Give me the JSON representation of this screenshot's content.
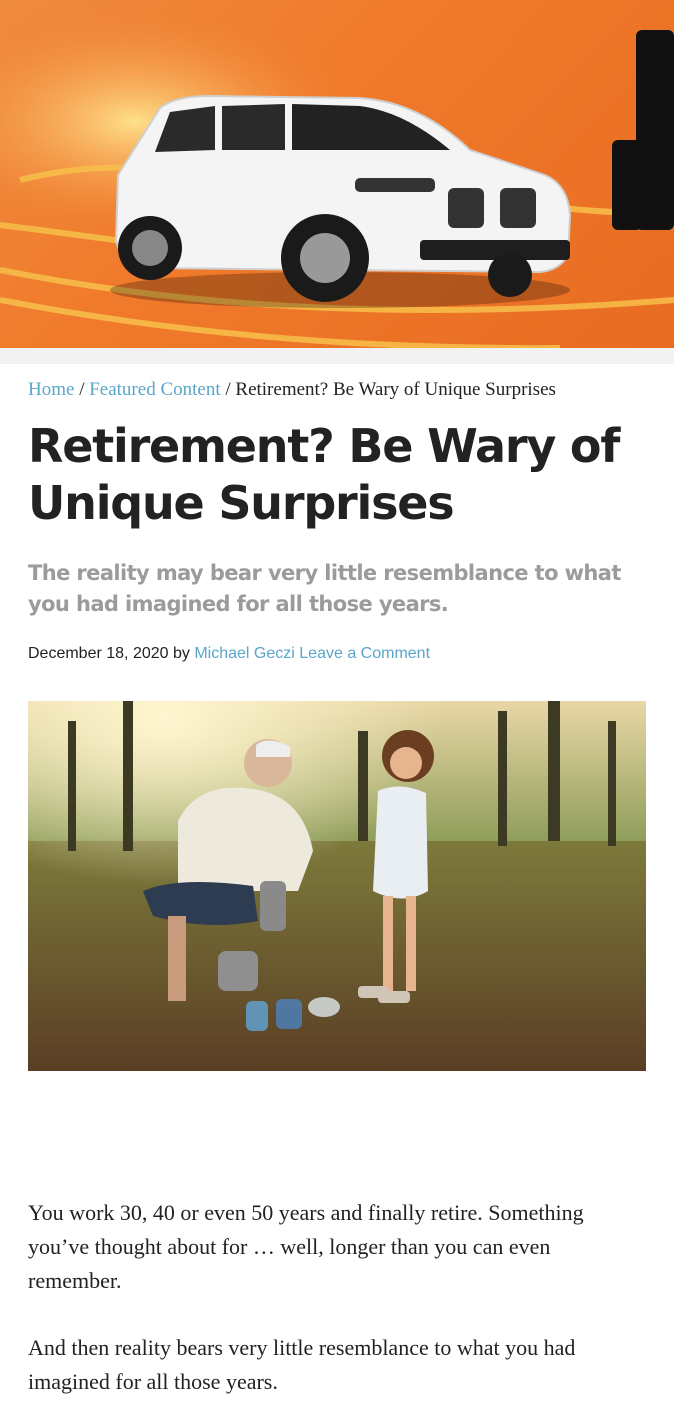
{
  "breadcrumb": {
    "home": "Home",
    "separator": "/",
    "category": "Featured Content",
    "current": "Retirement? Be Wary of Unique Surprises"
  },
  "article": {
    "title": "Retirement? Be Wary of Unique Surprises",
    "subtitle": "The reality may bear very little resemblance to what you had imagined for all those years.",
    "date": "December 18, 2020",
    "by": "by",
    "author": "Michael Geczi",
    "comment_link": "Leave a Comment",
    "paragraphs": [
      "You work 30, 40 or even 50 years and finally retire. Something you’ve thought about for … well, longer than you can even remember.",
      "And then reality bears very little resemblance to what you had imagined for all those years."
    ]
  },
  "colors": {
    "link": "#5aa6c8",
    "banner_orange": "#f07a2b",
    "subtitle_gray": "#9b9b9b"
  }
}
